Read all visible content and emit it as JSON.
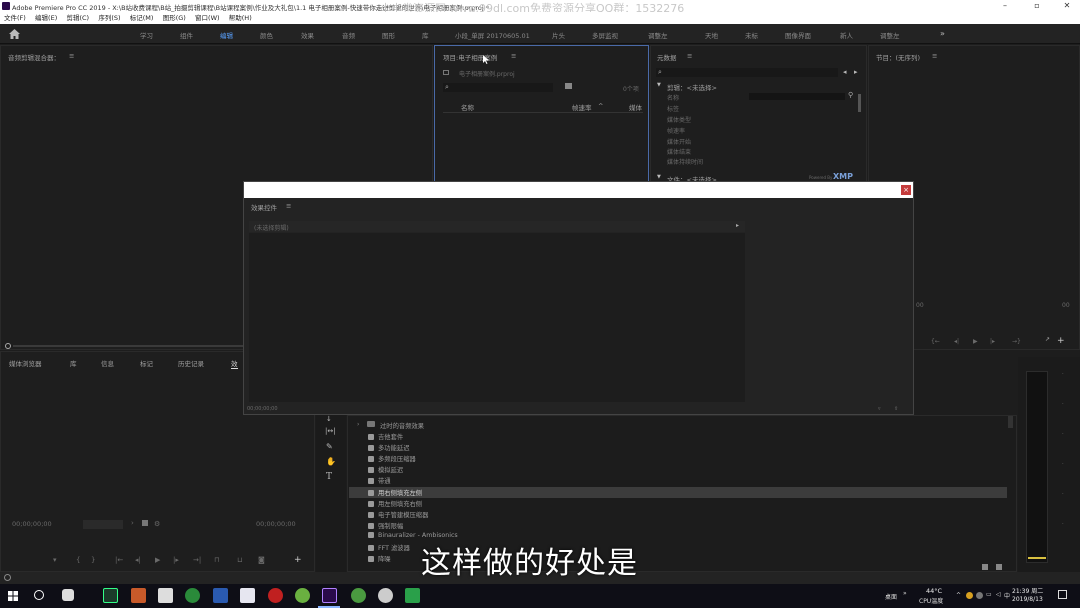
{
  "window": {
    "title": "Adobe Premiere Pro CC 2019 - X:\\B站收费课程\\B站_拍摄剪辑课程\\B站课程案例\\作业及大礼包\\1.1 电子相册案例-快速带你走进剪辑的世界\\电子相册案例.prproj *",
    "watermark": "小小卷资源网 www.99dl.com免费资源分享QQ群：1532276"
  },
  "menu": [
    "文件(F)",
    "编辑(E)",
    "剪辑(C)",
    "序列(S)",
    "标记(M)",
    "图形(G)",
    "窗口(W)",
    "帮助(H)"
  ],
  "workspaces": {
    "items": [
      "学习",
      "组件",
      "编辑",
      "颜色",
      "效果",
      "音频",
      "图形",
      "库",
      "小段_单屏 20170605.01",
      "片头",
      "多屏监视",
      "调整左",
      "天地",
      "未标",
      "图像界面",
      "新人",
      "调整左"
    ],
    "active_index": 2
  },
  "audio_mixer": {
    "title": "音频剪辑混合器："
  },
  "project": {
    "title": "项目:电子相册案例",
    "file": "电子相册案例.prproj",
    "item_count": "0个项",
    "col_name": "名称",
    "col_fps": "帧速率",
    "col_media": "媒体"
  },
  "metadata": {
    "title": "元数据",
    "clip_label": "剪辑：<未选择>",
    "fields": [
      "名称",
      "标签",
      "媒体类型",
      "帧速率",
      "媒体开始",
      "媒体结束",
      "媒体持续时间"
    ],
    "file_label": "文件：<未选择>",
    "powered": "Powered By",
    "xmp": "XMP"
  },
  "program": {
    "title": "节目：(无序列)",
    "tc_left": "00",
    "tc_right": "00"
  },
  "effect_controls": {
    "title": "效果控件",
    "no_clip": "(未选择剪辑)",
    "timecode": "00;00;00;00"
  },
  "source": {
    "tabs": [
      "媒体浏览器",
      "库",
      "信息",
      "标记",
      "历史记录",
      "效"
    ],
    "tc_left": "00;00;00;00",
    "tc_right": "00;00;00;00"
  },
  "effects_list": [
    "过时的音频效果",
    "吉他套件",
    "多功能延迟",
    "多频段压缩器",
    "模拟延迟",
    "带通",
    "用右侧填充左侧",
    "用左侧填充右侧",
    "电子管建模压缩器",
    "强制限幅",
    "Binauralizer - Ambisonics",
    "FFT 滤波器",
    "降噪"
  ],
  "effects_selected_index": 6,
  "subtitle": "这样做的好处是",
  "taskbar": {
    "weather_temp": "44°C",
    "weather_label": "CPU温度",
    "desktop_label": "桌面",
    "time": "21:39 周二",
    "date": "2019/8/13"
  },
  "colors": {
    "accent": "#5aa2ff",
    "panel": "#1e1e1e",
    "close": "#c43b3b",
    "premiere": "#2a0a4a"
  }
}
